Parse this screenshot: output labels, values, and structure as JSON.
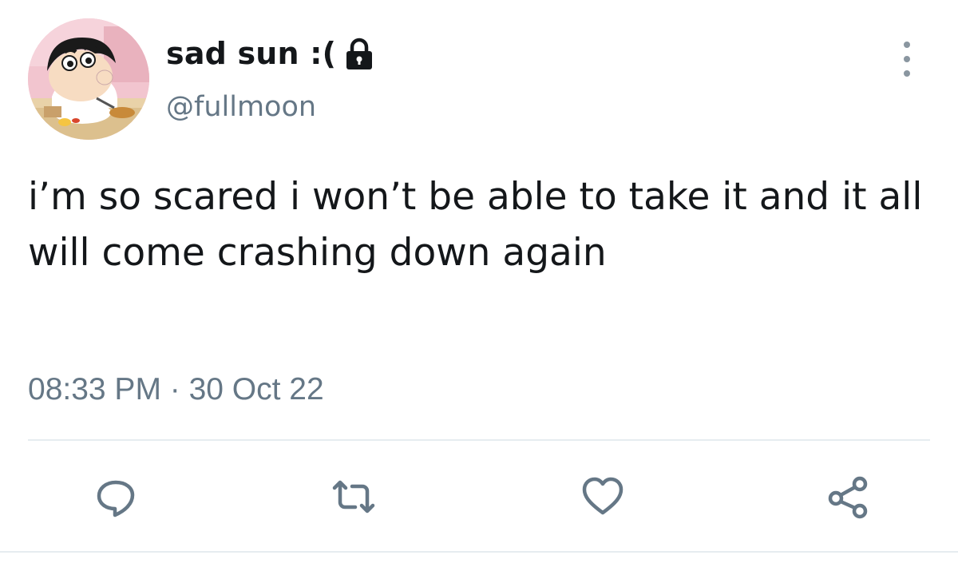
{
  "tweet": {
    "display_name": "sad sun :(",
    "handle": "@fullmoon",
    "text": "i’m so scared i won’t be able to take it and it all will come crashing down again",
    "timestamp": "08:33 PM · 30 Oct 22",
    "protected": true
  },
  "icons": {
    "lock": "lock-icon",
    "more": "more-options-icon",
    "reply": "reply-icon",
    "retweet": "retweet-icon",
    "like": "heart-icon",
    "share": "share-icon"
  },
  "colors": {
    "text_primary": "#14171a",
    "text_secondary": "#657786",
    "icon": "#657786",
    "divider": "#e6ecf0",
    "avatar_bg": "#f3c6d0"
  }
}
